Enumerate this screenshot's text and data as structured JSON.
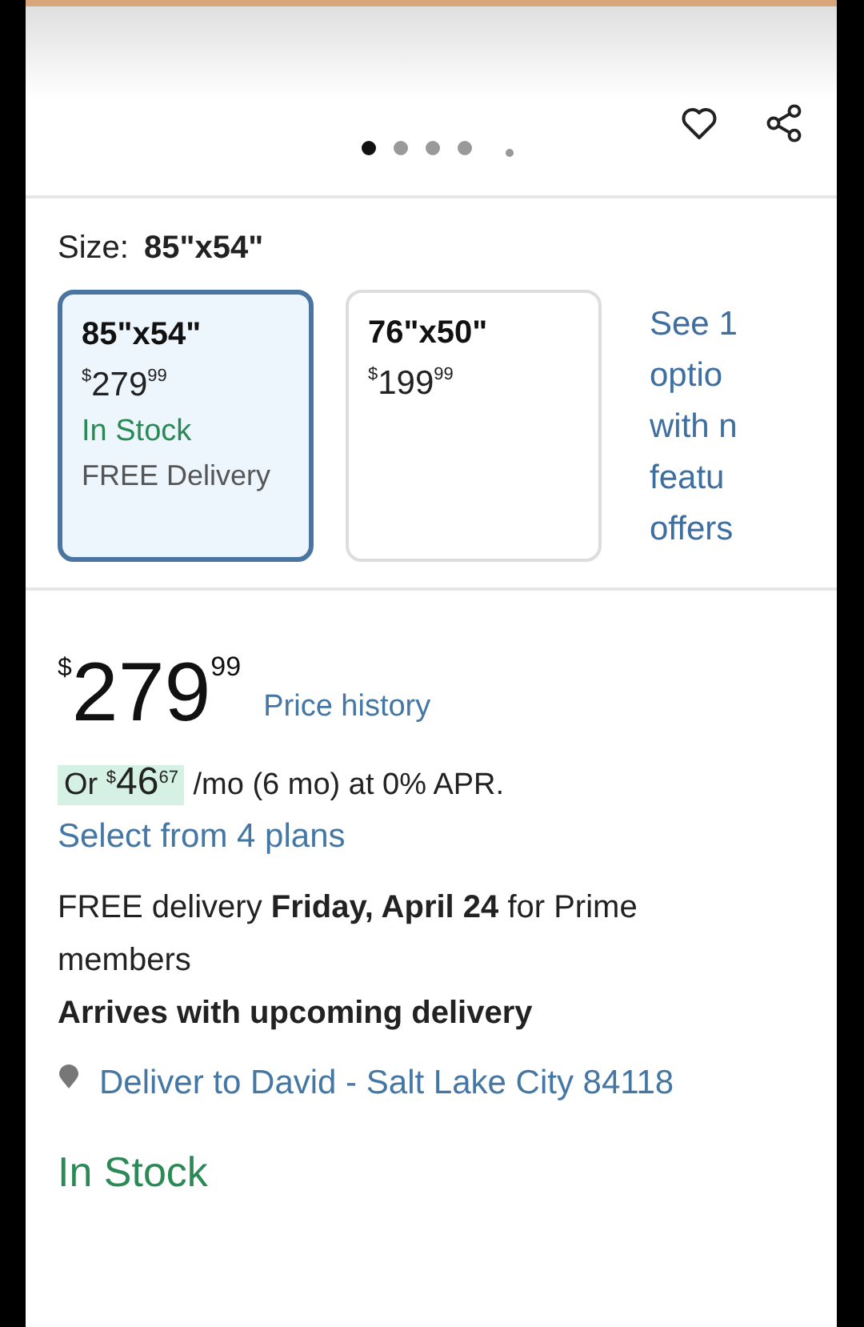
{
  "carousel": {
    "dots": [
      {
        "kind": "dot",
        "selected": true
      },
      {
        "kind": "dot",
        "selected": false
      },
      {
        "kind": "dot",
        "selected": false
      },
      {
        "kind": "dot",
        "selected": false
      },
      {
        "kind": "more",
        "selected": false
      }
    ]
  },
  "size": {
    "label": "Size:",
    "value": "85\"x54\"",
    "options": [
      {
        "name": "85\"x54\"",
        "price": {
          "symbol": "$",
          "whole": "279",
          "fraction": "99"
        },
        "availability": "In Stock",
        "delivery": "FREE Delivery",
        "selected": true
      },
      {
        "name": "76\"x50\"",
        "price": {
          "symbol": "$",
          "whole": "199",
          "fraction": "99"
        },
        "selected": false
      }
    ],
    "more_link": [
      "See 1",
      "optio",
      "with n",
      "featu",
      "offers"
    ]
  },
  "price": {
    "symbol": "$",
    "whole": "279",
    "fraction": "99",
    "history_link": "Price history"
  },
  "financing": {
    "lead": "Or",
    "symbol": "$",
    "whole": "46",
    "fraction": "67",
    "rest": "/mo (6 mo) at 0% APR.",
    "plans_link": "Select from 4 plans"
  },
  "delivery": {
    "text": "FREE delivery **Friday, April 24** for Prime members",
    "note": "Arrives with upcoming delivery",
    "location": "Deliver to David - Salt Lake City 84118"
  },
  "stock": "In Stock"
}
